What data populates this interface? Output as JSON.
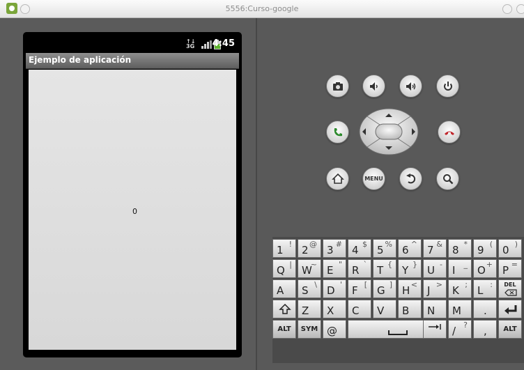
{
  "window": {
    "title": "5556:Curso-google"
  },
  "status_bar": {
    "time": "4:45",
    "network_icon": "3g-data-icon",
    "signal_icon": "signal-icon",
    "battery_icon": "battery-icon"
  },
  "app": {
    "title": "Ejemplo de aplicación",
    "counter": "0"
  },
  "controls": {
    "row1": [
      "camera-icon",
      "volume-down-icon",
      "volume-up-icon",
      "power-icon"
    ],
    "row2": [
      "call-icon",
      "dpad",
      "end-call-icon"
    ],
    "row3": [
      "home-icon",
      "menu",
      "back-icon",
      "search-icon"
    ],
    "menu_label": "MENU"
  },
  "keyboard": {
    "row1": [
      [
        "1",
        "!"
      ],
      [
        "2",
        "@"
      ],
      [
        "3",
        "#"
      ],
      [
        "4",
        "$"
      ],
      [
        "5",
        "%"
      ],
      [
        "6",
        "^"
      ],
      [
        "7",
        "&"
      ],
      [
        "8",
        "*"
      ],
      [
        "9",
        "("
      ],
      [
        "0",
        ")"
      ]
    ],
    "row2": [
      [
        "Q",
        "|"
      ],
      [
        "W",
        "~"
      ],
      [
        "E",
        "\""
      ],
      [
        "R",
        "`"
      ],
      [
        "T",
        "{"
      ],
      [
        "Y",
        "}"
      ],
      [
        "U",
        "-"
      ],
      [
        "I",
        "_"
      ],
      [
        "O",
        "+"
      ],
      [
        "P",
        "="
      ]
    ],
    "row3": [
      [
        "A",
        ""
      ],
      [
        "S",
        "\\"
      ],
      [
        "D",
        "'"
      ],
      [
        "F",
        "["
      ],
      [
        "G",
        "]"
      ],
      [
        "H",
        "<"
      ],
      [
        "J",
        ">"
      ],
      [
        "K",
        ";"
      ],
      [
        "L",
        ":"
      ],
      [
        "DEL",
        ""
      ]
    ],
    "row4": [
      [
        "shift",
        ""
      ],
      [
        "Z",
        ""
      ],
      [
        "X",
        ""
      ],
      [
        "C",
        ""
      ],
      [
        "V",
        ""
      ],
      [
        "B",
        ""
      ],
      [
        "N",
        ""
      ],
      [
        "M",
        ""
      ],
      [
        ".",
        ""
      ],
      [
        "enter",
        ""
      ]
    ],
    "row5": [
      [
        "ALT",
        ""
      ],
      [
        "SYM",
        ""
      ],
      [
        "@",
        ""
      ],
      [
        "space",
        ""
      ],
      [
        "/",
        "?"
      ],
      [
        ",",
        ""
      ],
      [
        "ALT",
        ""
      ]
    ]
  }
}
